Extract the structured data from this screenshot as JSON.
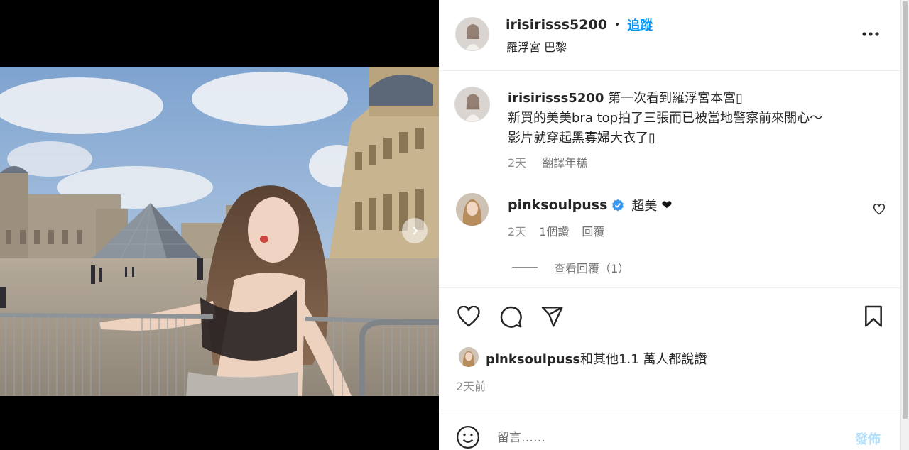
{
  "post": {
    "author": "irisirisss5200",
    "follow_label": "追蹤",
    "separator": "•",
    "location": "羅浮宮 巴黎",
    "more_icon": "more-horizontal-icon"
  },
  "caption": {
    "username": "irisirisss5200",
    "line1": "第一次看到羅浮宮本宮▯",
    "line2": "新買的美美bra top拍了三張而已被當地警察前來關心～",
    "line3": "影片就穿起黑寡婦大衣了▯",
    "time": "2天",
    "translate_label": "翻譯年糕"
  },
  "comment": {
    "username": "pinksoulpuss",
    "text": "超美",
    "emoji": "❤",
    "time": "2天",
    "likes": "1個讚",
    "reply_label": "回覆",
    "view_replies": "查看回覆（1）"
  },
  "actions": {
    "like_icon": "heart-icon",
    "comment_icon": "comment-icon",
    "share_icon": "send-icon",
    "save_icon": "bookmark-icon"
  },
  "likes_summary": {
    "user": "pinksoulpuss",
    "rest": "和其他1.1 萬人都說讚"
  },
  "post_time": "2天前",
  "composer": {
    "placeholder": "留言……",
    "post_label": "發佈",
    "emoji_icon": "smiley-icon"
  },
  "colors": {
    "link_blue": "#0095f6",
    "verified_blue": "#3897f0",
    "muted": "#8e8e8e",
    "post_disabled": "#b2dffc"
  }
}
